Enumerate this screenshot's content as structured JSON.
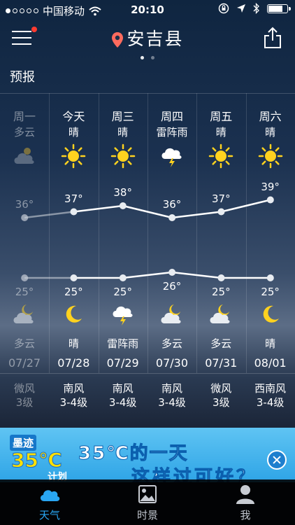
{
  "status_bar": {
    "carrier": "中国移动",
    "time": "20:10",
    "signal_dots_filled": 1,
    "signal_dots_total": 5,
    "battery_level": 0.8
  },
  "header": {
    "city": "安吉县",
    "page_count": 2,
    "current_page": 1
  },
  "section": {
    "title": "预报"
  },
  "forecast": [
    {
      "day": "周一",
      "condition_day": "多云",
      "icon_day": "cloud-icon",
      "high": "36°",
      "low": "25°",
      "icon_night": "cloud-moon-icon",
      "condition_night": "多云",
      "date": "07/27",
      "wind_dir": "微风",
      "wind_level": "3级",
      "past": true
    },
    {
      "day": "今天",
      "condition_day": "晴",
      "icon_day": "sun-icon",
      "high": "37°",
      "low": "25°",
      "icon_night": "moon-icon",
      "condition_night": "晴",
      "date": "07/28",
      "wind_dir": "南风",
      "wind_level": "3-4级",
      "past": false
    },
    {
      "day": "周三",
      "condition_day": "晴",
      "icon_day": "sun-icon",
      "high": "38°",
      "low": "25°",
      "icon_night": "thunder-cloud-icon",
      "condition_night": "雷阵雨",
      "date": "07/29",
      "wind_dir": "南风",
      "wind_level": "3-4级",
      "past": false
    },
    {
      "day": "周四",
      "condition_day": "雷阵雨",
      "icon_day": "thunder-cloud-icon",
      "high": "36°",
      "low": "26°",
      "icon_night": "cloud-moon-icon",
      "condition_night": "多云",
      "date": "07/30",
      "wind_dir": "南风",
      "wind_level": "3-4级",
      "past": false
    },
    {
      "day": "周五",
      "condition_day": "晴",
      "icon_day": "sun-icon",
      "high": "37°",
      "low": "25°",
      "icon_night": "cloud-moon-icon",
      "condition_night": "多云",
      "date": "07/31",
      "wind_dir": "微风",
      "wind_level": "3级",
      "past": false
    },
    {
      "day": "周六",
      "condition_day": "晴",
      "icon_day": "sun-icon",
      "high": "39°",
      "low": "25°",
      "icon_night": "moon-icon",
      "condition_night": "晴",
      "date": "08/01",
      "wind_dir": "西南风",
      "wind_level": "3-4级",
      "past": false
    }
  ],
  "chart_data": {
    "type": "line",
    "categories": [
      "07/27",
      "07/28",
      "07/29",
      "07/30",
      "07/31",
      "08/01"
    ],
    "series": [
      {
        "values": [
          36,
          37,
          38,
          36,
          37,
          39
        ]
      },
      {
        "values": [
          25,
          25,
          25,
          26,
          25,
          25
        ]
      }
    ]
  },
  "ad": {
    "logo_top": "墨迹",
    "logo_temp": "35℃",
    "logo_bottom": "计划",
    "headline": "35℃的一天",
    "subline": "这样过可好？"
  },
  "tabs": [
    {
      "label": "天气",
      "icon": "cloud-icon",
      "active": true
    },
    {
      "label": "时景",
      "icon": "photo-icon",
      "active": false
    },
    {
      "label": "我",
      "icon": "person-icon",
      "active": false
    }
  ],
  "colors": {
    "accent": "#29a6f2",
    "sun": "#ffd21f",
    "notification": "#ff3b30"
  }
}
